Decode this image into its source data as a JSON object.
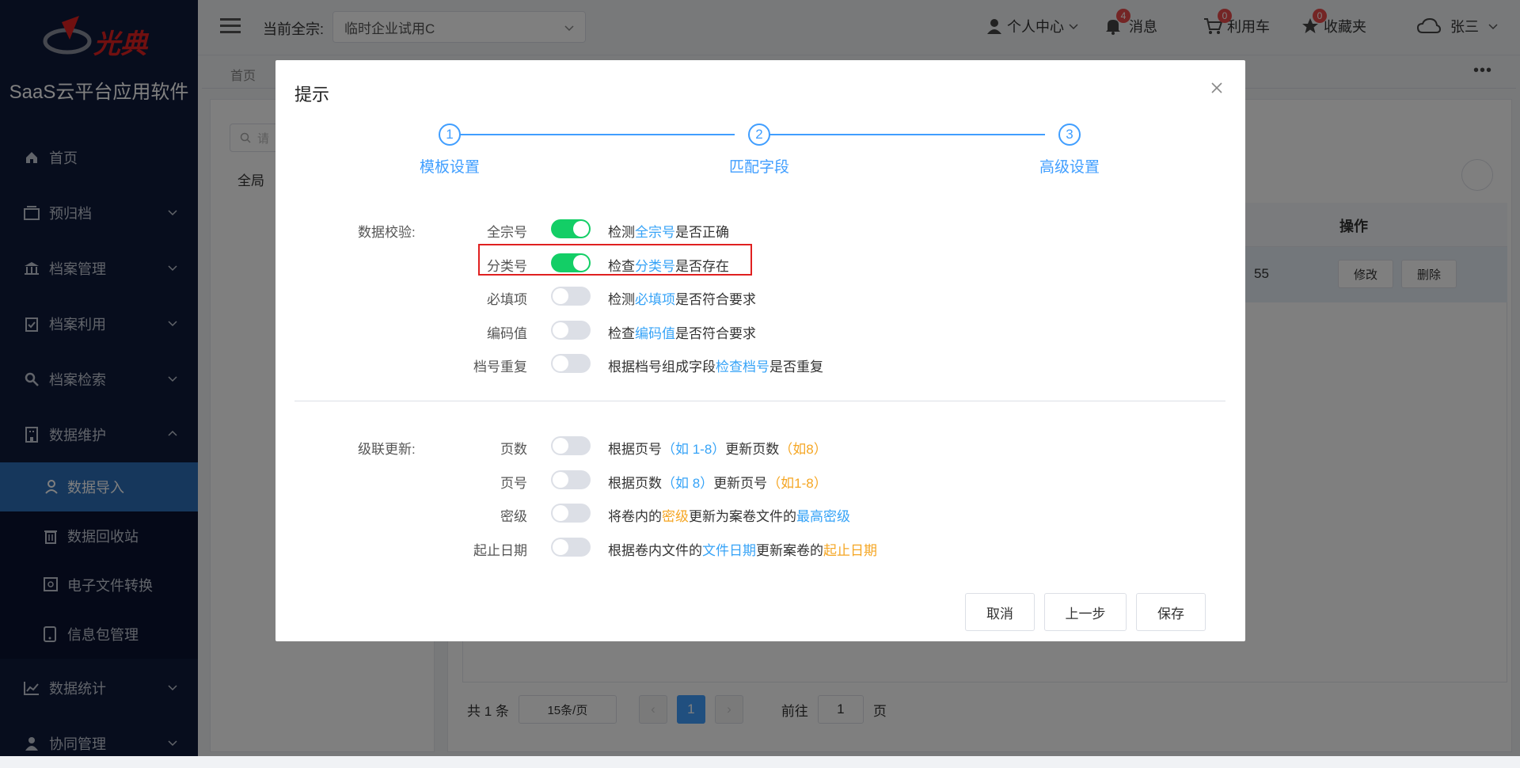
{
  "app": {
    "logo_text": "光典",
    "title": "SaaS云平台应用软件"
  },
  "sidebar": {
    "items": [
      {
        "label": "首页",
        "icon": "home-icon"
      },
      {
        "label": "预归档",
        "icon": "archive-box-icon"
      },
      {
        "label": "档案管理",
        "icon": "bank-icon"
      },
      {
        "label": "档案利用",
        "icon": "clipboard-icon"
      },
      {
        "label": "档案检索",
        "icon": "search-icon"
      },
      {
        "label": "数据维护",
        "icon": "building-icon"
      },
      {
        "label": "数据统计",
        "icon": "chart-line-icon"
      },
      {
        "label": "协同管理",
        "icon": "user-icon"
      }
    ],
    "sub_items": [
      {
        "label": "数据导入"
      },
      {
        "label": "数据回收站"
      },
      {
        "label": "电子文件转换"
      },
      {
        "label": "信息包管理"
      }
    ]
  },
  "header": {
    "fonds_label": "当前全宗:",
    "fonds_value": "临时企业试用C",
    "personal": "个人中心",
    "messages": "消息",
    "messages_count": "4",
    "cart": "利用车",
    "cart_count": "0",
    "favorites": "收藏夹",
    "favorites_count": "0",
    "user": "张三"
  },
  "tabs": {
    "home": "首页"
  },
  "background": {
    "tree_root": "全局",
    "table_header_op": "操作",
    "row_partial": "55",
    "edit": "修改",
    "delete": "删除",
    "search_placeholder": "请",
    "pagination": {
      "total": "共 1 条",
      "page_size": "15条/页",
      "current": "1",
      "goto": "前往",
      "goto_value": "1",
      "page_unit": "页"
    }
  },
  "modal": {
    "title": "提示",
    "steps": [
      {
        "num": "1",
        "label": "模板设置"
      },
      {
        "num": "2",
        "label": "匹配字段"
      },
      {
        "num": "3",
        "label": "高级设置"
      }
    ],
    "validation": {
      "section_label": "数据校验:",
      "rows": [
        {
          "label": "全宗号",
          "on": true,
          "parts": [
            [
              "检测",
              ""
            ],
            [
              "全宗号",
              "blue"
            ],
            [
              "是否正确",
              ""
            ]
          ]
        },
        {
          "label": "分类号",
          "on": true,
          "parts": [
            [
              "检查",
              ""
            ],
            [
              "分类号",
              "blue"
            ],
            [
              "是否存在",
              ""
            ]
          ]
        },
        {
          "label": "必填项",
          "on": false,
          "parts": [
            [
              "检测",
              ""
            ],
            [
              "必填项",
              "blue"
            ],
            [
              "是否符合要求",
              ""
            ]
          ]
        },
        {
          "label": "编码值",
          "on": false,
          "parts": [
            [
              "检查",
              ""
            ],
            [
              "编码值",
              "blue"
            ],
            [
              "是否符合要求",
              ""
            ]
          ]
        },
        {
          "label": "档号重复",
          "on": false,
          "parts": [
            [
              "根据档号组成字段",
              ""
            ],
            [
              "检查档号",
              "blue"
            ],
            [
              "是否重复",
              ""
            ]
          ]
        }
      ]
    },
    "cascade": {
      "section_label": "级联更新:",
      "rows": [
        {
          "label": "页数",
          "on": false,
          "parts": [
            [
              "根据页号",
              ""
            ],
            [
              "（如 1-8）",
              "blue"
            ],
            [
              "更新页数",
              ""
            ],
            [
              "（如8）",
              "orange"
            ]
          ]
        },
        {
          "label": "页号",
          "on": false,
          "parts": [
            [
              "根据页数",
              ""
            ],
            [
              "（如 8）",
              "blue"
            ],
            [
              "更新页号",
              ""
            ],
            [
              "（如1-8）",
              "orange"
            ]
          ]
        },
        {
          "label": "密级",
          "on": false,
          "parts": [
            [
              "将卷内的",
              ""
            ],
            [
              "密级",
              "orange"
            ],
            [
              "更新为案卷文件的",
              ""
            ],
            [
              "最高密级",
              "blue"
            ]
          ]
        },
        {
          "label": "起止日期",
          "on": false,
          "parts": [
            [
              "根据卷内文件的",
              ""
            ],
            [
              "文件日期",
              "blue"
            ],
            [
              "更新案卷的",
              ""
            ],
            [
              "起止日期",
              "orange"
            ]
          ]
        }
      ]
    },
    "buttons": {
      "cancel": "取消",
      "prev": "上一步",
      "save": "保存"
    }
  },
  "colors": {
    "sidebar_bg": "#0e1a3b",
    "accent": "#409eff",
    "switch_on": "#13ce66",
    "highlight": "#e02020"
  }
}
